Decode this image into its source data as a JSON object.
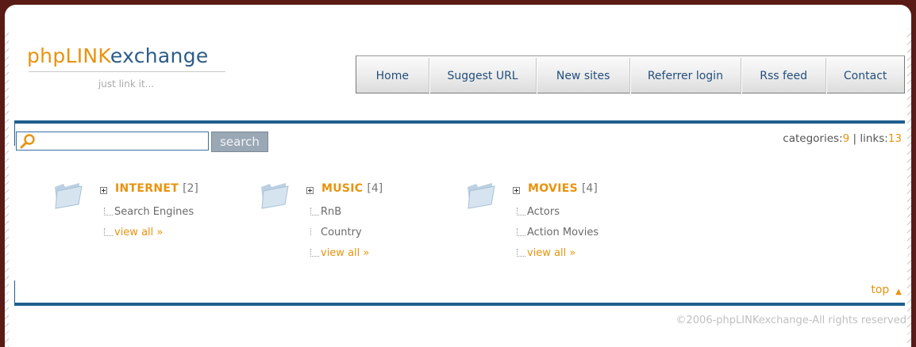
{
  "brand": {
    "name_part1": "phpLINK",
    "name_part2": "exchange",
    "tagline": "just link it..."
  },
  "nav": {
    "items": [
      {
        "label": "Home"
      },
      {
        "label": "Suggest URL"
      },
      {
        "label": "New sites"
      },
      {
        "label": "Referrer login"
      },
      {
        "label": "Rss feed"
      },
      {
        "label": "Contact"
      }
    ]
  },
  "search": {
    "value": "",
    "placeholder": "",
    "button_label": "search"
  },
  "stats": {
    "categories_label": "categories:",
    "categories_count": "9",
    "separator": " | ",
    "links_label": "links:",
    "links_count": "13"
  },
  "categories": [
    {
      "name": "INTERNET",
      "count": "[2]",
      "subs": [
        "Search Engines"
      ],
      "view_all": "view all »"
    },
    {
      "name": "MUSIC",
      "count": "[4]",
      "subs": [
        "RnB",
        "Country"
      ],
      "view_all": "view all »"
    },
    {
      "name": "MOVIES",
      "count": "[4]",
      "subs": [
        "Actors",
        "Action Movies"
      ],
      "view_all": "view all »"
    }
  ],
  "top_link": {
    "label": "top",
    "arrow": "▲"
  },
  "footer": {
    "text": "©2006-phpLINKexchange-All rights reserved"
  },
  "colors": {
    "accent": "#e8930f",
    "link": "#244f7c",
    "frame": "#1f5f8f",
    "background": "#5a1a16"
  }
}
